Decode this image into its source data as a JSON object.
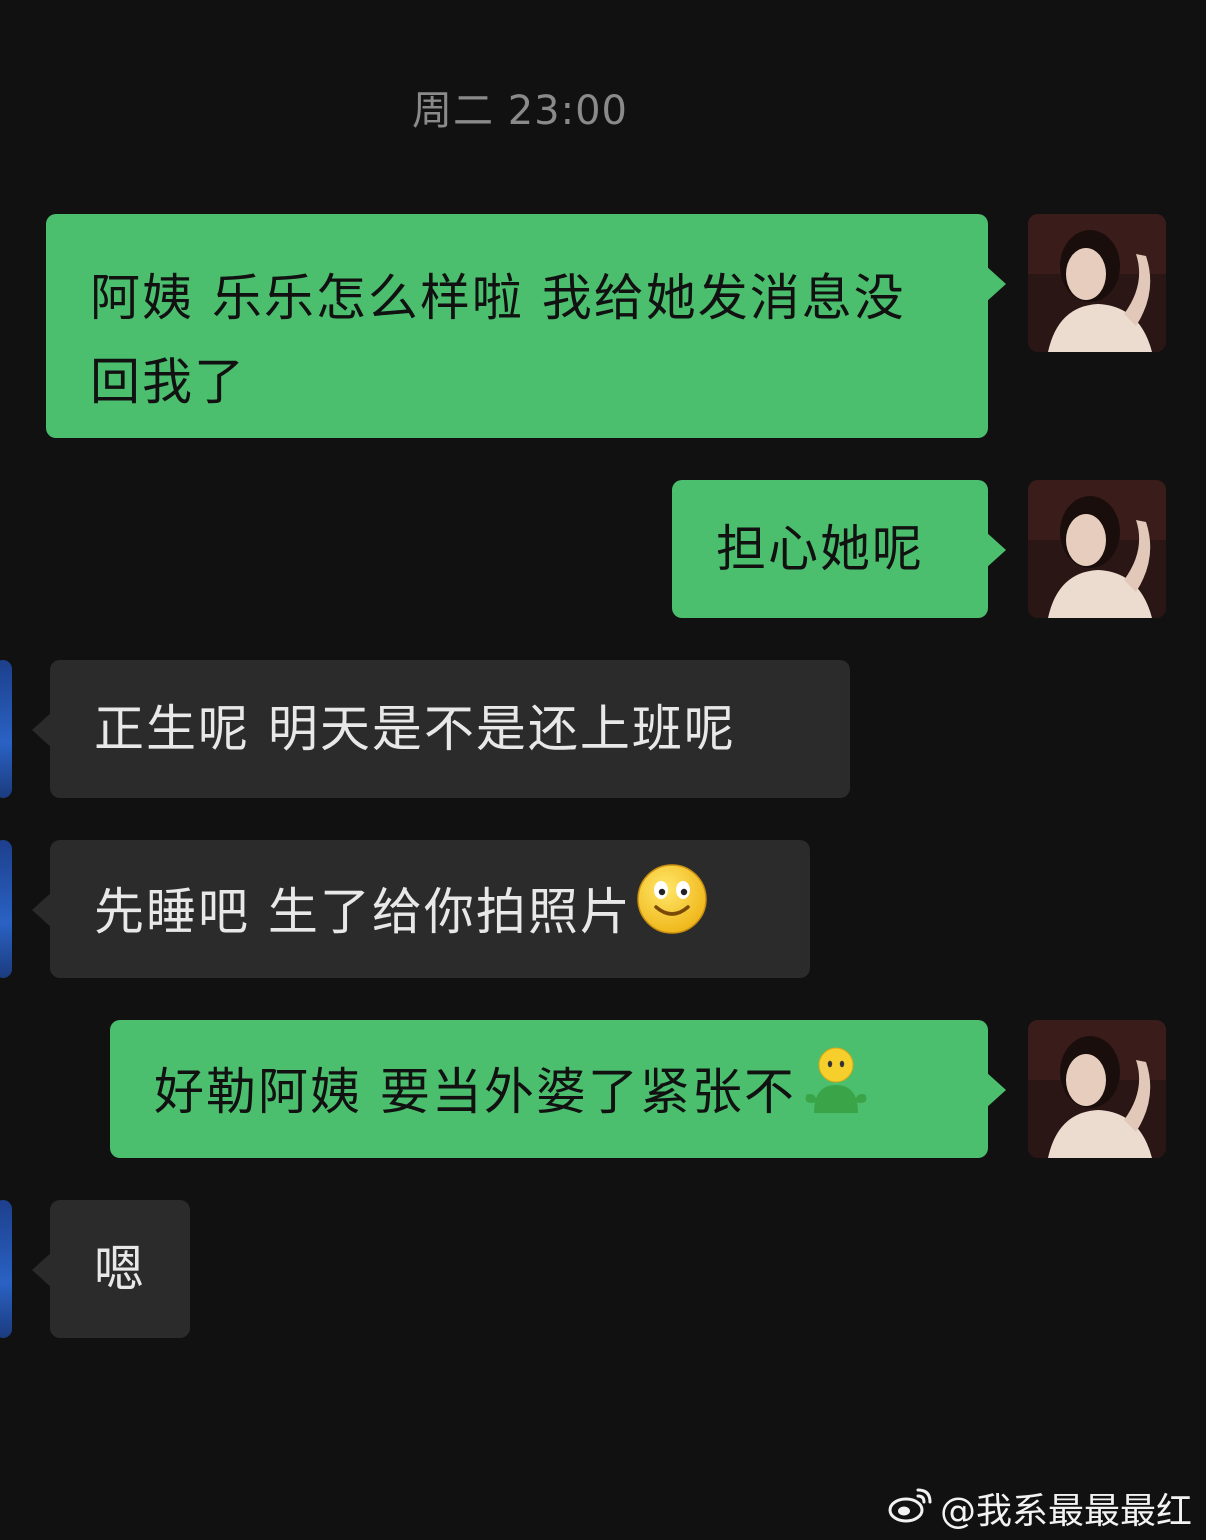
{
  "chat": {
    "timestamp": "周二 23:00",
    "messages": [
      {
        "side": "sent",
        "text": "阿姨  乐乐怎么样啦 我给她发消息没回我了"
      },
      {
        "side": "sent",
        "text": "担心她呢"
      },
      {
        "side": "recv",
        "text": "正生呢 明天是不是还上班呢"
      },
      {
        "side": "recv",
        "text": "先睡吧 生了给你拍照片",
        "emoji": "smiley-face-icon"
      },
      {
        "side": "sent",
        "text": "好勒阿姨 要当外婆了紧张不",
        "emoji": "green-person-shrug-icon"
      },
      {
        "side": "recv",
        "text": "嗯"
      }
    ]
  },
  "watermark": {
    "text": "@我系最最最红",
    "icon": "weibo-logo-icon"
  },
  "colors": {
    "background": "#111111",
    "sent_bubble": "#4cbf6f",
    "recv_bubble": "#2b2b2b",
    "timestamp": "#8a8a8a"
  }
}
